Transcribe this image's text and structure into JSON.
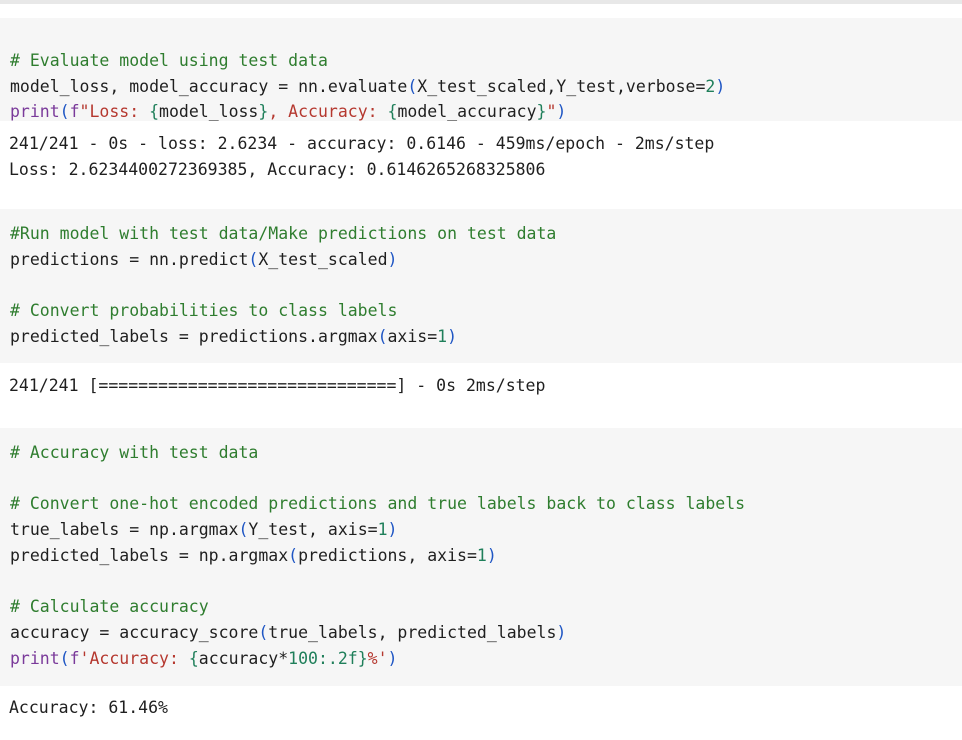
{
  "cells": [
    {
      "kind": "code",
      "lines": [
        {
          "parts": [
            {
              "t": "# Evaluate model using test data",
              "c": "cm"
            }
          ]
        },
        {
          "parts": [
            {
              "t": "model_loss, model_accuracy = nn.evaluate",
              "c": "tx"
            },
            {
              "t": "(",
              "c": "br"
            },
            {
              "t": "X_test_scaled,Y_test,verbose=",
              "c": "tx"
            },
            {
              "t": "2",
              "c": "nm"
            },
            {
              "t": ")",
              "c": "br"
            }
          ]
        },
        {
          "parts": [
            {
              "t": "print",
              "c": "kw"
            },
            {
              "t": "(",
              "c": "br"
            },
            {
              "t": "f",
              "c": "kw"
            },
            {
              "t": "\"Loss: ",
              "c": "st"
            },
            {
              "t": "{",
              "c": "nm"
            },
            {
              "t": "model_loss",
              "c": "tx"
            },
            {
              "t": "}",
              "c": "nm"
            },
            {
              "t": ", Accuracy: ",
              "c": "st"
            },
            {
              "t": "{",
              "c": "nm"
            },
            {
              "t": "model_accuracy",
              "c": "tx"
            },
            {
              "t": "}",
              "c": "nm"
            },
            {
              "t": "\"",
              "c": "st"
            },
            {
              "t": ")",
              "c": "br"
            }
          ]
        }
      ]
    },
    {
      "kind": "output",
      "lines": [
        "241/241 - 0s - loss: 2.6234 - accuracy: 0.6146 - 459ms/epoch - 2ms/step",
        "Loss: 2.6234400272369385, Accuracy: 0.6146265268325806"
      ]
    },
    {
      "kind": "code",
      "lines": [
        {
          "parts": [
            {
              "t": "#Run model with test data/Make predictions on test data",
              "c": "cm"
            }
          ]
        },
        {
          "parts": [
            {
              "t": "predictions = nn.predict",
              "c": "tx"
            },
            {
              "t": "(",
              "c": "br"
            },
            {
              "t": "X_test_scaled",
              "c": "tx"
            },
            {
              "t": ")",
              "c": "br"
            }
          ]
        },
        {
          "parts": [
            {
              "t": "",
              "c": "tx"
            }
          ]
        },
        {
          "parts": [
            {
              "t": "# Convert probabilities to class labels",
              "c": "cm"
            }
          ]
        },
        {
          "parts": [
            {
              "t": "predicted_labels = predictions.argmax",
              "c": "tx"
            },
            {
              "t": "(",
              "c": "br"
            },
            {
              "t": "axis=",
              "c": "tx"
            },
            {
              "t": "1",
              "c": "nm"
            },
            {
              "t": ")",
              "c": "br"
            }
          ]
        }
      ]
    },
    {
      "kind": "output",
      "lines": [
        "241/241 [==============================] - 0s 2ms/step"
      ]
    },
    {
      "kind": "code",
      "lines": [
        {
          "parts": [
            {
              "t": "# Accuracy with test data",
              "c": "cm"
            }
          ]
        },
        {
          "parts": [
            {
              "t": "",
              "c": "tx"
            }
          ]
        },
        {
          "parts": [
            {
              "t": "# Convert one-hot encoded predictions and true labels back to class labels",
              "c": "cm"
            }
          ]
        },
        {
          "parts": [
            {
              "t": "true_labels = np.argmax",
              "c": "tx"
            },
            {
              "t": "(",
              "c": "br"
            },
            {
              "t": "Y_test, axis=",
              "c": "tx"
            },
            {
              "t": "1",
              "c": "nm"
            },
            {
              "t": ")",
              "c": "br"
            }
          ]
        },
        {
          "parts": [
            {
              "t": "predicted_labels = np.argmax",
              "c": "tx"
            },
            {
              "t": "(",
              "c": "br"
            },
            {
              "t": "predictions, axis=",
              "c": "tx"
            },
            {
              "t": "1",
              "c": "nm"
            },
            {
              "t": ")",
              "c": "br"
            }
          ]
        },
        {
          "parts": [
            {
              "t": "",
              "c": "tx"
            }
          ]
        },
        {
          "parts": [
            {
              "t": "# Calculate accuracy",
              "c": "cm"
            }
          ]
        },
        {
          "parts": [
            {
              "t": "accuracy = accuracy_score",
              "c": "tx"
            },
            {
              "t": "(",
              "c": "br"
            },
            {
              "t": "true_labels, predicted_labels",
              "c": "tx"
            },
            {
              "t": ")",
              "c": "br"
            }
          ]
        },
        {
          "parts": [
            {
              "t": "print",
              "c": "kw"
            },
            {
              "t": "(",
              "c": "br"
            },
            {
              "t": "f",
              "c": "kw"
            },
            {
              "t": "'Accuracy: ",
              "c": "st"
            },
            {
              "t": "{",
              "c": "nm"
            },
            {
              "t": "accuracy*",
              "c": "tx"
            },
            {
              "t": "100",
              "c": "nm"
            },
            {
              "t": ":.2f",
              "c": "nm"
            },
            {
              "t": "}",
              "c": "nm"
            },
            {
              "t": "%'",
              "c": "st"
            },
            {
              "t": ")",
              "c": "br"
            }
          ]
        }
      ]
    },
    {
      "kind": "output",
      "lines": [
        "Accuracy: 61.46%"
      ]
    }
  ]
}
